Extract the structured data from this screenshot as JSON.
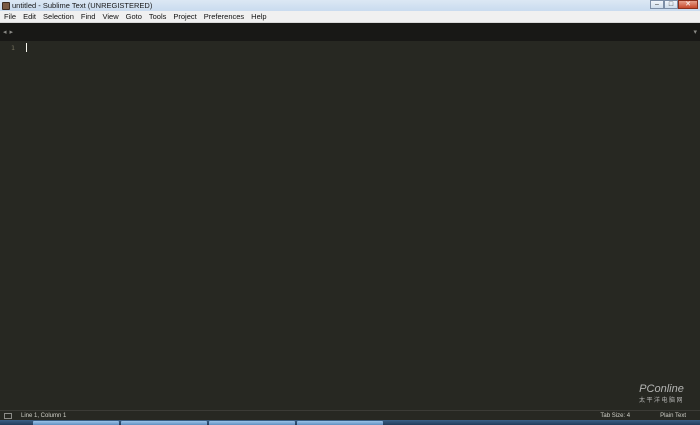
{
  "window": {
    "title": "untitled - Sublime Text (UNREGISTERED)",
    "controls": {
      "minimize": "–",
      "maximize": "□",
      "close": "✕"
    }
  },
  "menu": [
    {
      "label": "File"
    },
    {
      "label": "Edit"
    },
    {
      "label": "Selection"
    },
    {
      "label": "Find"
    },
    {
      "label": "View"
    },
    {
      "label": "Goto"
    },
    {
      "label": "Tools"
    },
    {
      "label": "Project"
    },
    {
      "label": "Preferences"
    },
    {
      "label": "Help"
    }
  ],
  "tabbar": {
    "prev_icon": "◂",
    "next_icon": "▸",
    "dropdown_icon": "▾"
  },
  "editor": {
    "line_numbers": [
      "1"
    ],
    "background": "#272822",
    "gutter_color": "#75715e"
  },
  "statusbar": {
    "position": "Line 1, Column 1",
    "tab_size": "Tab Size: 4",
    "syntax": "Plain Text"
  },
  "watermark": {
    "brand": "PConline",
    "sub": "太平洋电脑网"
  },
  "taskbar": {
    "buttons": 4
  }
}
